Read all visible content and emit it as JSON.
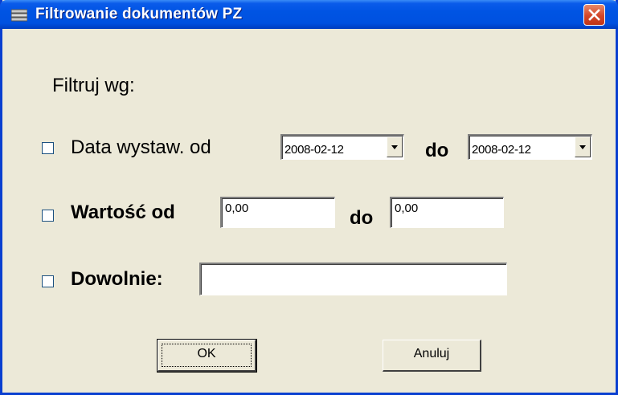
{
  "window": {
    "title": "Filtrowanie dokumentów PZ"
  },
  "filter": {
    "heading": "Filtruj wg:",
    "date": {
      "label": "Data wystaw. od",
      "from": "2008-02-12",
      "to_label": "do",
      "to": "2008-02-12",
      "checked": false
    },
    "value": {
      "label": "Wartość od",
      "from": "0,00",
      "to_label": "do",
      "to": "0,00",
      "checked": false
    },
    "any": {
      "label": "Dowolnie:",
      "value": "",
      "checked": false
    }
  },
  "buttons": {
    "ok": "OK",
    "cancel": "Anuluj"
  },
  "colors": {
    "titlebar": "#0054e3",
    "dialog_bg": "#ece9d8",
    "close": "#d2462a"
  }
}
